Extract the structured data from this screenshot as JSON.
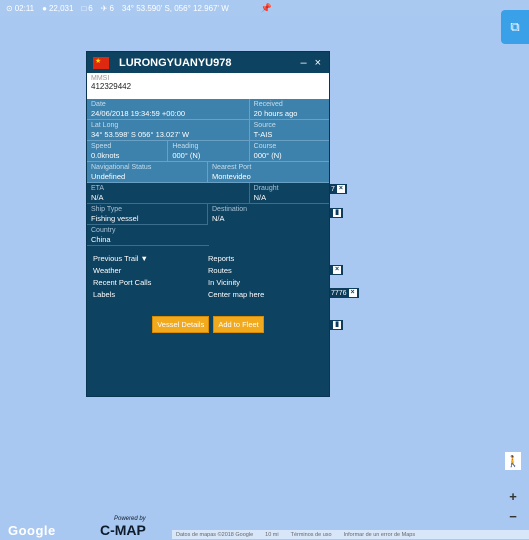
{
  "topbar": {
    "time": "02:11",
    "count": "22,031",
    "boxes": "6",
    "planes": "6",
    "coords": "34° 53.590' S, 056° 12.967' W"
  },
  "tags": [
    {
      "label": "7"
    },
    {
      "label": ""
    },
    {
      "label": ""
    },
    {
      "label": "7776"
    },
    {
      "label": ""
    }
  ],
  "popup": {
    "vessel_name": "LURONGYUANYU978",
    "minimize": "–",
    "close": "×",
    "mmsi": {
      "label": "MMSI",
      "value": "412329442"
    },
    "date": {
      "label": "Date",
      "value": "24/06/2018 19:34:59 +00:00"
    },
    "received": {
      "label": "Received",
      "value": "20 hours ago"
    },
    "latlong": {
      "label": "Lat Long",
      "value": "34° 53.598' S 056° 13.027' W"
    },
    "source": {
      "label": "Source",
      "value": "T-AIS"
    },
    "speed": {
      "label": "Speed",
      "value": "0.0knots"
    },
    "heading": {
      "label": "Heading",
      "value": "000° (N)"
    },
    "course": {
      "label": "Course",
      "value": "000° (N)"
    },
    "nav_status": {
      "label": "Navigational Status",
      "value": "Undefined"
    },
    "nearest_port": {
      "label": "Nearest Port",
      "value": "Montevideo"
    },
    "eta": {
      "label": "ETA",
      "value": "N/A"
    },
    "draught": {
      "label": "Draught",
      "value": "N/A"
    },
    "ship_type": {
      "label": "Ship Type",
      "value": "Fishing vessel"
    },
    "destination": {
      "label": "Destination",
      "value": "N/A"
    },
    "country": {
      "label": "Country",
      "value": "China"
    },
    "links": {
      "previous_trail": "Previous Trail ▼",
      "reports": "Reports",
      "weather": "Weather",
      "routes": "Routes",
      "recent_port_calls": "Recent Port Calls",
      "in_vicinity": "In Vicinity",
      "labels": "Labels",
      "center_map": "Center map here"
    },
    "buttons": {
      "vessel_details": "Vessel Details",
      "add_to_fleet": "Add to Fleet"
    }
  },
  "map": {
    "google_logo": "Google",
    "powered_by": "Powered by",
    "cmap_logo": "C-MAP",
    "attribution": "Datos de mapas ©2018 Google",
    "scale": "10 mi",
    "terms": "Términos de uso",
    "report": "Informar de un error de Maps"
  }
}
